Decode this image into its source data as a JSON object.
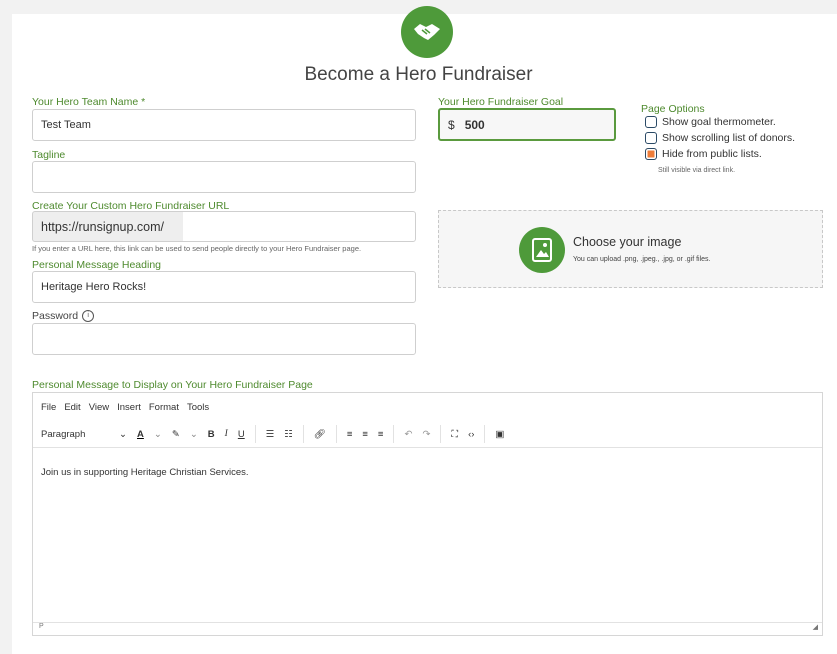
{
  "title": "Become a Hero Fundraiser",
  "fields": {
    "team_name_label": "Your Hero Team Name *",
    "team_name_value": "Test Team",
    "tagline_label": "Tagline",
    "tagline_value": "",
    "url_label": "Create Your Custom Hero Fundraiser URL",
    "url_prefix": "https://runsignup.com/",
    "url_hint": "If you enter a URL here, this link can be used to send people directly to your Hero Fundraiser page.",
    "heading_label": "Personal Message Heading",
    "heading_value": "Heritage Hero Rocks!",
    "password_label": "Password",
    "password_value": ""
  },
  "goal": {
    "label": "Your Hero Fundraiser Goal",
    "currency": "$",
    "value": "500"
  },
  "options": {
    "label": "Page Options",
    "items": [
      {
        "label": "Show goal thermometer.",
        "checked": false
      },
      {
        "label": "Show scrolling list of donors.",
        "checked": false
      },
      {
        "label": "Hide from public lists.",
        "checked": true
      }
    ],
    "note": "Still visible via direct link."
  },
  "image_upload": {
    "heading": "Choose your image",
    "subtext": "You can upload .png, .jpeg., .jpg, or .gif files."
  },
  "editor": {
    "label": "Personal Message to Display on Your Hero Fundraiser Page",
    "menu": [
      "File",
      "Edit",
      "View",
      "Insert",
      "Format",
      "Tools"
    ],
    "block_format": "Paragraph",
    "content": "Join us in supporting Heritage Christian Services.",
    "status_path": "P"
  },
  "colors": {
    "accent": "#4e9a3a",
    "label_green": "#4e8a2e",
    "checkbox_checked": "#ee7d3a"
  }
}
